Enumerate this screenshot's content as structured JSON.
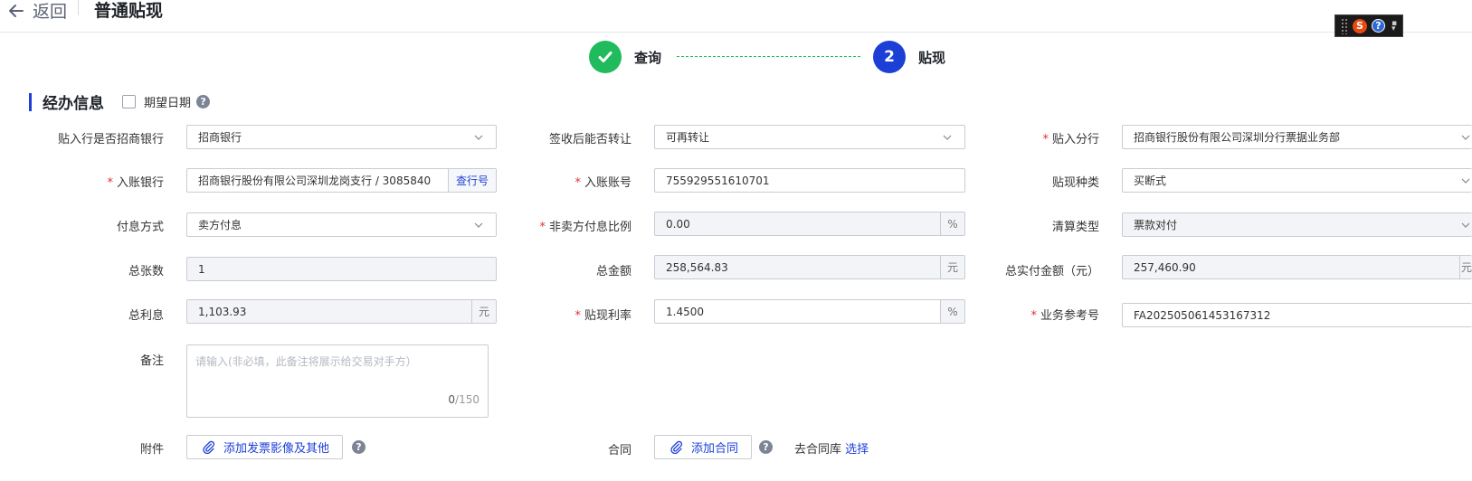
{
  "header": {
    "back_label": "返回",
    "title": "普通贴现"
  },
  "steps": [
    {
      "label": "查询",
      "status": "done"
    },
    {
      "number": "2",
      "label": "贴现",
      "status": "active"
    }
  ],
  "section": {
    "title": "经办信息",
    "expected_date_label": "期望日期",
    "expected_date_checked": false
  },
  "form": {
    "bank_is_cmb": {
      "label": "贴入行是否招商银行",
      "value": "招商银行"
    },
    "transferable": {
      "label": "签收后能否转让",
      "value": "可再转让"
    },
    "branch": {
      "label": "贴入分行",
      "value": "招商银行股份有限公司深圳分行票据业务部"
    },
    "account_bank": {
      "label": "入账银行",
      "value": "招商银行股份有限公司深圳龙岗支行 / 3085840",
      "button": "查行号"
    },
    "account_no": {
      "label": "入账账号",
      "value": "755929551610701"
    },
    "discount_type": {
      "label": "贴现种类",
      "value": "买断式"
    },
    "interest_method": {
      "label": "付息方式",
      "value": "卖方付息"
    },
    "nonseller_ratio": {
      "label": "非卖方付息比例",
      "value": "0.00",
      "unit": "%"
    },
    "settlement_type": {
      "label": "清算类型",
      "value": "票款对付"
    },
    "total_count": {
      "label": "总张数",
      "value": "1"
    },
    "total_amount": {
      "label": "总金额",
      "value": "258,564.83",
      "unit": "元"
    },
    "total_paid": {
      "label": "总实付金额（元）",
      "value": "257,460.90",
      "unit": "元"
    },
    "total_interest": {
      "label": "总利息",
      "value": "1,103.93",
      "unit": "元"
    },
    "discount_rate": {
      "label": "贴现利率",
      "value": "1.4500",
      "unit": "%"
    },
    "biz_ref": {
      "label": "业务参考号",
      "value": "FA202505061453167312"
    },
    "remark": {
      "label": "备注",
      "placeholder": "请输入(非必填，此备注将展示给交易对手方）",
      "count": "0",
      "max": "/150"
    },
    "attachment": {
      "label": "附件",
      "button": "添加发票影像及其他"
    },
    "contract": {
      "label": "合同",
      "button": "添加合同",
      "library_text": "去合同库",
      "library_link": "选择"
    }
  }
}
